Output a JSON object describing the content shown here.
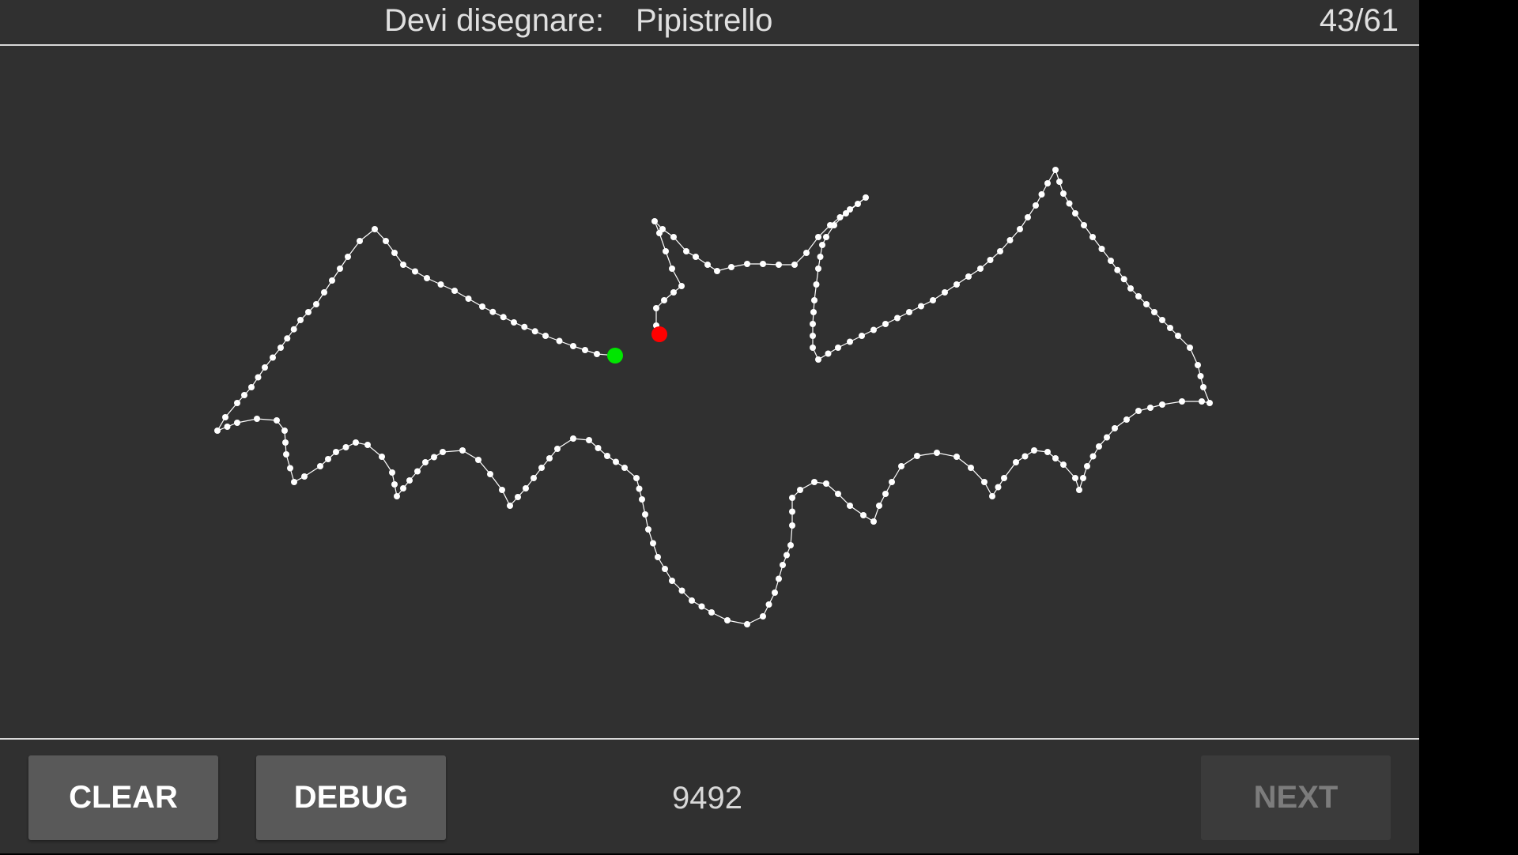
{
  "header": {
    "prompt_label": "Devi disegnare:",
    "prompt_target": "Pipistrello",
    "progress": "43/61"
  },
  "drawing": {
    "stroke_color": "#ffffff",
    "start_marker_color": "#00e600",
    "end_marker_color": "#ff0000"
  },
  "footer": {
    "clear_label": "CLEAR",
    "debug_label": "DEBUG",
    "score": "9492",
    "next_label": "NEXT"
  }
}
